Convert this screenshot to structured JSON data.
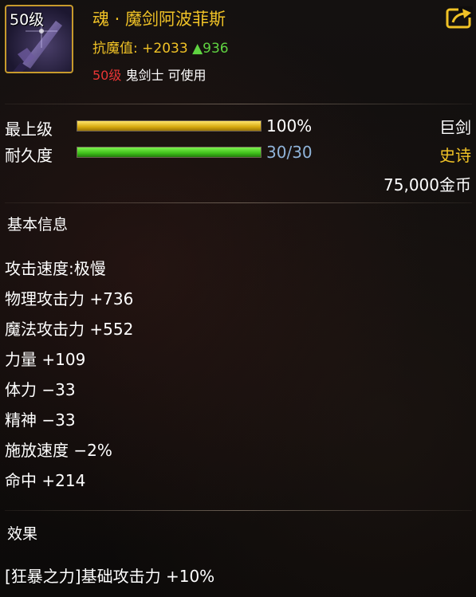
{
  "item": {
    "icon_level": "50级",
    "name": "魂 · 魔剑阿波菲斯",
    "anti_magic_label": "抗魔值:",
    "anti_magic_value": "+2033",
    "anti_magic_bonus": "▲936",
    "req_level": "50级",
    "req_class": " 鬼剑士 可使用",
    "share_icon": "share-icon"
  },
  "bars": [
    {
      "label": "最上级",
      "value_text": "100%",
      "fraction": 1.0,
      "style": "gold",
      "value_color": "#ffffff"
    },
    {
      "label": "耐久度",
      "value_text": "30/30",
      "fraction": 1.0,
      "style": "green",
      "value_color": "#8fb3d9"
    }
  ],
  "meta": {
    "weapon_type": "巨剑",
    "rarity": "史诗",
    "rarity_color": "#f0c226",
    "price": "75,000金币"
  },
  "basic": {
    "title": "基本信息",
    "attrs": [
      "攻击速度:极慢",
      "物理攻击力 +736",
      "魔法攻击力 +552",
      "力量 +109",
      "体力 −33",
      "精神 −33",
      "施放速度 −2%",
      "命中 +214"
    ]
  },
  "effects": {
    "title": "效果",
    "lines": [
      "[狂暴之力]基础攻击力 +10%"
    ]
  }
}
